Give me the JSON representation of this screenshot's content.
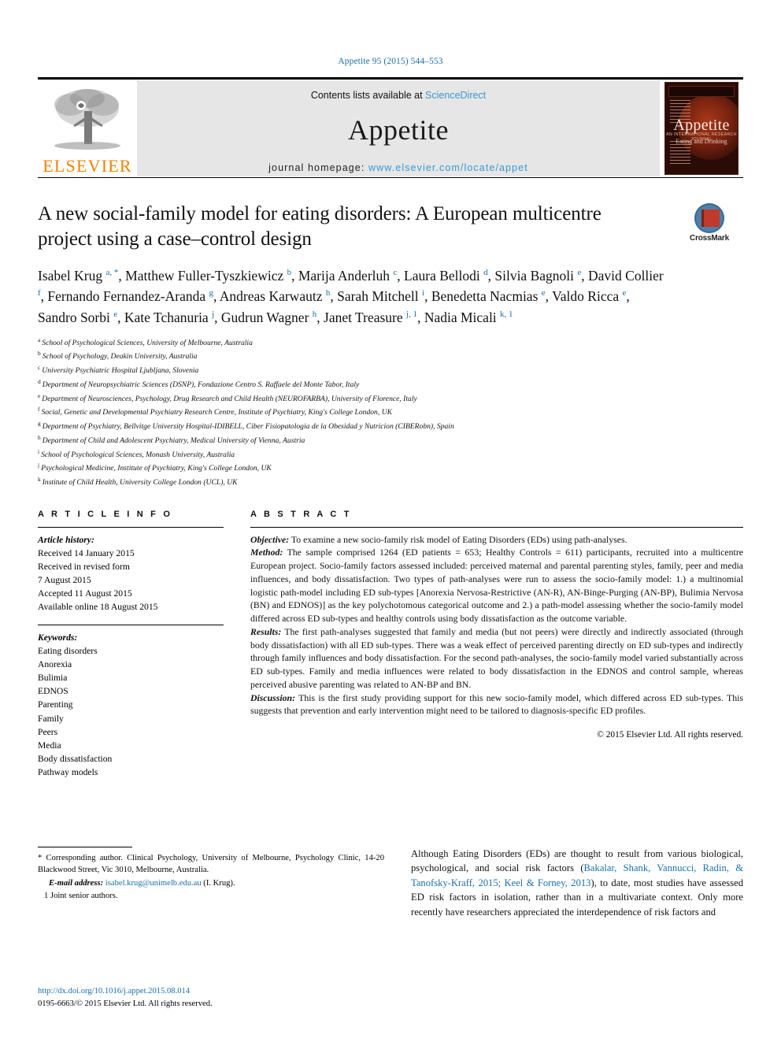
{
  "running_head": "Appetite 95 (2015) 544–553",
  "header": {
    "publisher": "ELSEVIER",
    "contents_prefix": "Contents lists available at ",
    "contents_link": "ScienceDirect",
    "journal_name": "Appetite",
    "homepage_prefix": "journal homepage: ",
    "homepage_url": "www.elsevier.com/locate/appet",
    "cover": {
      "title": "Appetite",
      "subtitle": "AN INTERNATIONAL RESEARCH JOURNAL",
      "tagline": "Eating and Drinking"
    }
  },
  "article": {
    "title": "A new social-family model for eating disorders: A European multicentre project using a case–control design",
    "crossmark_label": "CrossMark",
    "authors_html": "Isabel Krug <sup>a, *</sup>, Matthew Fuller-Tyszkiewicz <sup>b</sup>, Marija Anderluh <sup>c</sup>, Laura Bellodi <sup>d</sup>, Silvia Bagnoli <sup>e</sup>, David Collier <sup>f</sup>, Fernando Fernandez-Aranda <sup>g</sup>, Andreas Karwautz <sup>h</sup>, Sarah Mitchell <sup>i</sup>, Benedetta Nacmias <sup>e</sup>, Valdo Ricca <sup>e</sup>, Sandro Sorbi <sup>e</sup>, Kate Tchanuria <sup>j</sup>, Gudrun Wagner <sup>h</sup>, Janet Treasure <sup>j, 1</sup>, Nadia Micali <sup>k, 1</sup>",
    "affiliations": [
      {
        "mark": "a",
        "text": "School of Psychological Sciences, University of Melbourne, Australia"
      },
      {
        "mark": "b",
        "text": "School of Psychology, Deakin University, Australia"
      },
      {
        "mark": "c",
        "text": "University Psychiatric Hospital Ljubljana, Slovenia"
      },
      {
        "mark": "d",
        "text": "Department of Neuropsychiatric Sciences (DSNP), Fondazione Centro S. Raffaele del Monte Tabor, Italy"
      },
      {
        "mark": "e",
        "text": "Department of Neurosciences, Psychology, Drug Research and Child Health (NEUROFARBA), University of Florence, Italy"
      },
      {
        "mark": "f",
        "text": "Social, Genetic and Developmental Psychiatry Research Centre, Institute of Psychiatry, King's College London, UK"
      },
      {
        "mark": "g",
        "text": "Department of Psychiatry, Bellvitge University Hospital-IDIBELL, Ciber Fisiopatologia de la Obesidad y Nutricion (CIBERobn), Spain"
      },
      {
        "mark": "h",
        "text": "Department of Child and Adolescent Psychiatry, Medical University of Vienna, Austria"
      },
      {
        "mark": "i",
        "text": "School of Psychological Sciences, Monash University, Australia"
      },
      {
        "mark": "j",
        "text": "Psychological Medicine, Institute of Psychiatry, King's College London, UK"
      },
      {
        "mark": "k",
        "text": "Institute of Child Health, University College London (UCL), UK"
      }
    ]
  },
  "article_info": {
    "heading": "A R T I C L E   I N F O",
    "history_label": "Article history:",
    "history": [
      "Received 14 January 2015",
      "Received in revised form",
      "7 August 2015",
      "Accepted 11 August 2015",
      "Available online 18 August 2015"
    ],
    "keywords_label": "Keywords:",
    "keywords": [
      "Eating disorders",
      "Anorexia",
      "Bulimia",
      "EDNOS",
      "Parenting",
      "Family",
      "Peers",
      "Media",
      "Body dissatisfaction",
      "Pathway models"
    ]
  },
  "abstract": {
    "heading": "A B S T R A C T",
    "sections": [
      {
        "label": "Objective:",
        "text": " To examine a new socio-family risk model of Eating Disorders (EDs) using path-analyses."
      },
      {
        "label": "Method:",
        "text": " The sample comprised 1264 (ED patients = 653; Healthy Controls = 611) participants, recruited into a multicentre European project. Socio-family factors assessed included: perceived maternal and parental parenting styles, family, peer and media influences, and body dissatisfaction. Two types of path-analyses were run to assess the socio-family model: 1.) a multinomial logistic path-model including ED sub-types [Anorexia Nervosa-Restrictive (AN-R), AN-Binge-Purging (AN-BP), Bulimia Nervosa (BN) and EDNOS)] as the key polychotomous categorical outcome and 2.) a path-model assessing whether the socio-family model differed across ED sub-types and healthy controls using body dissatisfaction as the outcome variable."
      },
      {
        "label": "Results:",
        "text": " The first path-analyses suggested that family and media (but not peers) were directly and indirectly associated (through body dissatisfaction) with all ED sub-types. There was a weak effect of perceived parenting directly on ED sub-types and indirectly through family influences and body dissatisfaction. For the second path-analyses, the socio-family model varied substantially across ED sub-types. Family and media influences were related to body dissatisfaction in the EDNOS and control sample, whereas perceived abusive parenting was related to AN-BP and BN."
      },
      {
        "label": "Discussion:",
        "text": " This is the first study providing support for this new socio-family model, which differed across ED sub-types. This suggests that prevention and early intervention might need to be tailored to diagnosis-specific ED profiles."
      }
    ],
    "copyright": "© 2015 Elsevier Ltd. All rights reserved."
  },
  "footnotes": {
    "corresponding": "* Corresponding author. Clinical Psychology, University of Melbourne, Psychology Clinic, 14-20 Blackwood Street, Vic 3010, Melbourne, Australia.",
    "email_label": "E-mail address:",
    "email": "isabel.krug@unimelb.edu.au",
    "email_suffix": " (I. Krug).",
    "joint": "1  Joint senior authors."
  },
  "doi": {
    "url": "http://dx.doi.org/10.1016/j.appet.2015.08.014",
    "issn_line": "0195-6663/© 2015 Elsevier Ltd. All rights reserved."
  },
  "body": {
    "paragraph_start": "Although Eating Disorders (EDs) are thought to result from various biological, psychological, and social risk factors (",
    "citation": "Bakalar, Shank, Vannucci, Radin, & Tanofsky-Kraff, 2015; Keel & Forney, 2013",
    "paragraph_end": "), to date, most studies have assessed ED risk factors in isolation, rather than in a multivariate context. Only more recently have researchers appreciated the interdependence of risk factors and"
  },
  "colors": {
    "link": "#1a6ea8",
    "sciencedirect": "#3a97d4",
    "elsevier_orange": "#f08200",
    "band_gray": "#e6e6e6"
  }
}
